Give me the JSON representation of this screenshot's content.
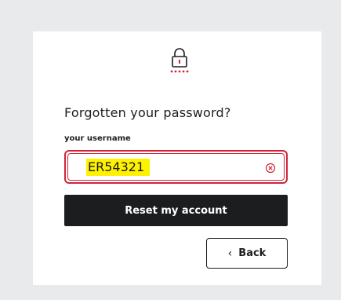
{
  "form": {
    "icon": "lock-with-password-dots-icon",
    "title": "Forgotten your password?",
    "field_label": "your username",
    "field_value": "ER54321",
    "clear_icon": "clear-circle-x-icon",
    "reset_label": "Reset my account",
    "back_label": "Back",
    "back_icon": "chevron-left-icon"
  },
  "colors": {
    "background": "#e9eaec",
    "card": "#ffffff",
    "accent_red": "#d0253a",
    "button_dark": "#1c1d1f",
    "highlight": "#fff200"
  }
}
